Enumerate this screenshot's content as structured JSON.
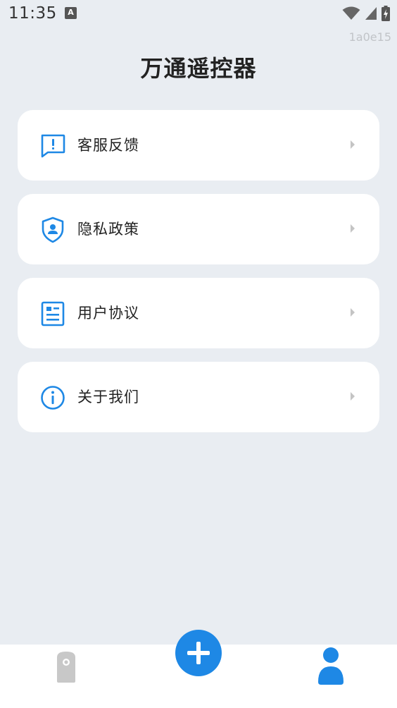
{
  "status_bar": {
    "time": "11:35",
    "notification_icon": "a-icon",
    "icons": [
      "wifi-icon",
      "signal-icon",
      "battery-charging-icon"
    ]
  },
  "build_id": "1a0e15",
  "title": "万通遥控器",
  "menu": [
    {
      "label": "客服反馈",
      "icon": "feedback-icon"
    },
    {
      "label": "隐私政策",
      "icon": "privacy-shield-icon"
    },
    {
      "label": "用户协议",
      "icon": "agreement-document-icon"
    },
    {
      "label": "关于我们",
      "icon": "info-icon"
    }
  ],
  "bottom_nav": {
    "items": [
      "remote-icon",
      "add-icon",
      "profile-icon"
    ],
    "active": "profile-icon"
  },
  "colors": {
    "accent": "#1e88e5",
    "background": "#e9edf2",
    "card": "#ffffff",
    "inactive": "#c8c8c8"
  }
}
